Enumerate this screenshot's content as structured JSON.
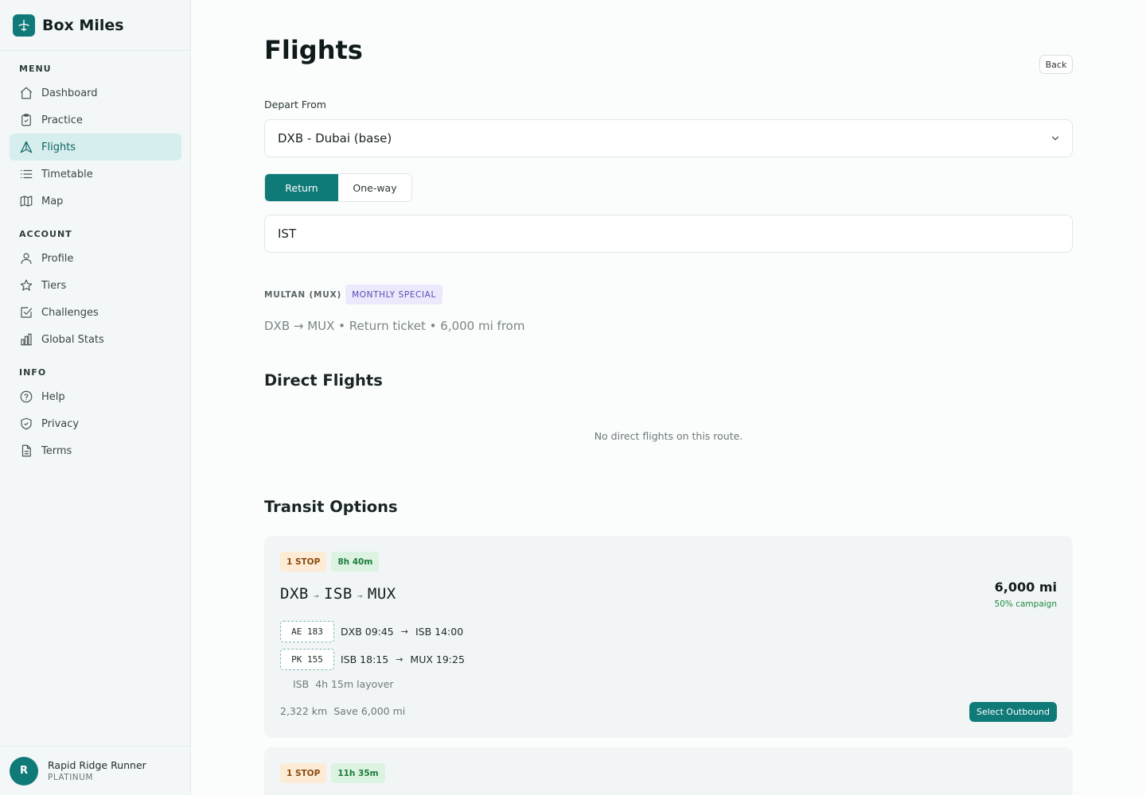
{
  "brand": {
    "name": "Box Miles"
  },
  "nav": {
    "menu_heading": "MENU",
    "menu": [
      {
        "label": "Dashboard",
        "icon": "home-icon"
      },
      {
        "label": "Practice",
        "icon": "clipboard-icon"
      },
      {
        "label": "Flights",
        "icon": "plane-icon",
        "active": true
      },
      {
        "label": "Timetable",
        "icon": "list-icon"
      },
      {
        "label": "Map",
        "icon": "map-icon"
      }
    ],
    "account_heading": "ACCOUNT",
    "account": [
      {
        "label": "Profile",
        "icon": "user-icon"
      },
      {
        "label": "Tiers",
        "icon": "star-icon"
      },
      {
        "label": "Challenges",
        "icon": "checkbox-icon"
      },
      {
        "label": "Global Stats",
        "icon": "bar-chart-icon"
      }
    ],
    "info_heading": "INFO",
    "info": [
      {
        "label": "Help",
        "icon": "help-circle-icon"
      },
      {
        "label": "Privacy",
        "icon": "shield-icon"
      },
      {
        "label": "Terms",
        "icon": "document-icon"
      }
    ]
  },
  "user": {
    "initial": "R",
    "name": "Rapid Ridge Runner",
    "tier": "PLATINUM"
  },
  "page": {
    "title": "Flights",
    "back_label": "Back",
    "depart_label": "Depart From",
    "depart_value": "DXB - Dubai (base)",
    "trip_types": [
      "Return",
      "One-way"
    ],
    "trip_type_selected": "Return",
    "destination_value": "IST"
  },
  "promo": {
    "city": "MULTAN (MUX)",
    "badge": "MONTHLY SPECIAL",
    "description": "DXB → MUX • Return ticket • 6,000 mi from"
  },
  "direct": {
    "heading": "Direct Flights",
    "empty": "No direct flights on this route."
  },
  "transit": {
    "heading": "Transit Options",
    "options": [
      {
        "stops": "1 STOP",
        "duration": "8h 40m",
        "route": [
          "DXB",
          "ISB",
          "MUX"
        ],
        "price": "6,000 mi",
        "campaign": "50% campaign",
        "legs": [
          {
            "flight": "AE 183",
            "from": "DXB 09:45",
            "to": "ISB 14:00"
          },
          {
            "flight": "PK 155",
            "from": "ISB 18:15",
            "to": "MUX 19:25"
          }
        ],
        "layover_airport": "ISB",
        "layover_text": "4h 15m layover",
        "distance": "2,322 km",
        "save": "Save 6,000 mi",
        "select_label": "Select Outbound"
      },
      {
        "stops": "1 STOP",
        "duration": "11h 35m"
      }
    ]
  },
  "colors": {
    "accent": "#0f7a78",
    "active_nav_bg": "#d7eeee",
    "promo_badge": "#5a4fb8"
  }
}
